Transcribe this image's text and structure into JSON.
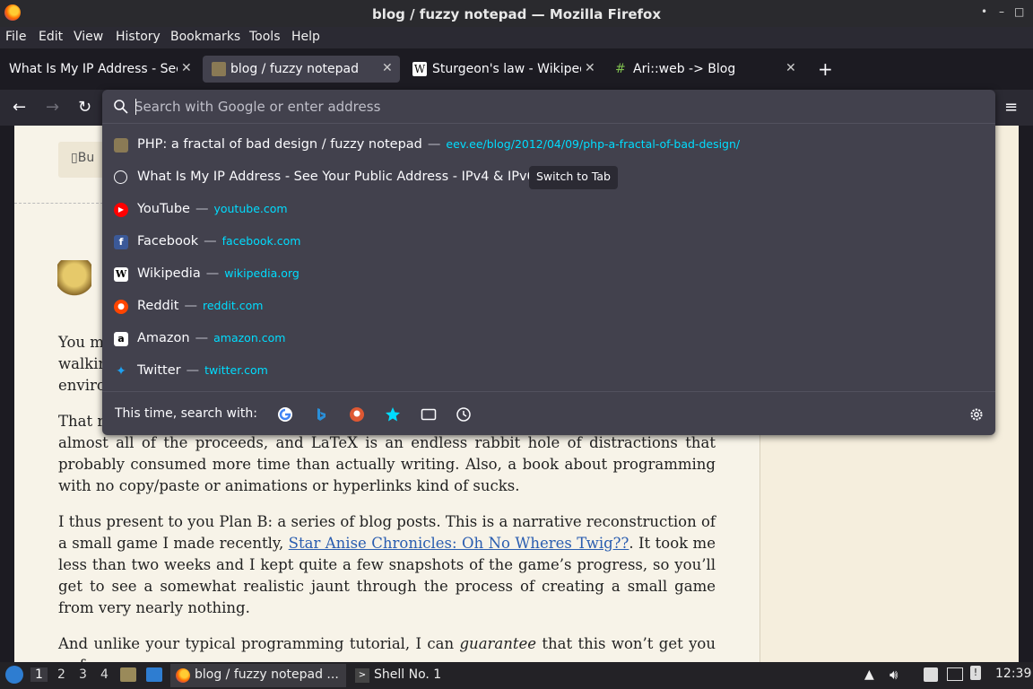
{
  "window": {
    "title": "blog / fuzzy notepad — Mozilla Firefox",
    "controls": [
      "•",
      "–",
      "□",
      "✕"
    ]
  },
  "menubar": {
    "items": [
      "File",
      "Edit",
      "View",
      "History",
      "Bookmarks",
      "Tools",
      "Help"
    ]
  },
  "tabs": [
    {
      "label": "What Is My IP Address - See",
      "favicon": "none"
    },
    {
      "label": "blog / fuzzy notepad",
      "favicon": "owl-icon",
      "active": true
    },
    {
      "label": "Sturgeon's law - Wikipedi",
      "favicon": "wikipedia-icon"
    },
    {
      "label": "Ari::web -> Blog",
      "favicon": "leaf-icon"
    }
  ],
  "new_tab_label": "+",
  "urlbar": {
    "placeholder": "Search with Google or enter address"
  },
  "suggestions": [
    {
      "title": "PHP: a fractal of bad design / fuzzy notepad",
      "url": "eev.ee/blog/2012/04/09/php-a-fractal-of-bad-design/",
      "icon": "owl-icon"
    },
    {
      "title": "What Is My IP Address - See Your Public Address - IPv4 & IPv6",
      "url": "",
      "icon": "globe-icon",
      "action": "Switch to Tab"
    },
    {
      "title": "YouTube",
      "url": "youtube.com",
      "icon": "youtube-icon"
    },
    {
      "title": "Facebook",
      "url": "facebook.com",
      "icon": "facebook-icon"
    },
    {
      "title": "Wikipedia",
      "url": "wikipedia.org",
      "icon": "wikipedia-icon"
    },
    {
      "title": "Reddit",
      "url": "reddit.com",
      "icon": "reddit-icon"
    },
    {
      "title": "Amazon",
      "url": "amazon.com",
      "icon": "amazon-icon"
    },
    {
      "title": "Twitter",
      "url": "twitter.com",
      "icon": "twitter-icon"
    }
  ],
  "search_with_label": "This time, search with:",
  "search_engines": [
    "google-icon",
    "bing-icon",
    "duckduckgo-icon",
    "bookmarks-star-icon",
    "tabs-icon",
    "history-clock-icon"
  ],
  "page": {
    "bu_button": "Bu",
    "para1_frag": [
      "You m",
      "walkin",
      "enviro"
    ],
    "para2_start": "That r",
    "para2_rest": "almost all of the proceeds, and LaTeX is an endless rabbit hole of distractions that probably consumed more time than actually writing. Also, a book about programming with no copy/paste or animations or hyperlinks kind of sucks.",
    "para3_before": "I thus present to you Plan B: a series of blog posts. This is a narrative reconstruction of a small game I made recently, ",
    "para3_link": "Star Anise Chronicles: Oh No Wheres Twig??",
    "para3_after": ". It took me less than two weeks and I kept quite a few snapshots of the game’s progress, so you’ll get to see a somewhat realistic jaunt through the process of creating a small game from very nearly nothing.",
    "para4_before": "And unlike your typical programming tutorial, I can ",
    "para4_em": "guarantee",
    "para4_after": " that this won’t get you as far"
  },
  "taskbar": {
    "workspaces": [
      "1",
      "2",
      "3",
      "4"
    ],
    "firefox_task": "blog / fuzzy notepad ...",
    "shell_task": "Shell No. 1",
    "clock": "12:39"
  },
  "colors": {
    "url_accent": "#00ddff",
    "panel_bg": "#42414d",
    "toolbar_bg": "#2b2a33"
  }
}
